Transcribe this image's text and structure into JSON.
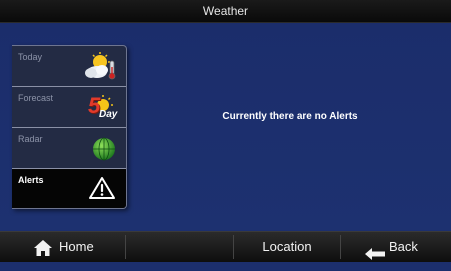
{
  "header": {
    "title": "Weather"
  },
  "main": {
    "message": "Currently there are no Alerts"
  },
  "sidebar": {
    "tabs": [
      {
        "label": "Today",
        "icon": "partly-cloudy-thermometer-icon"
      },
      {
        "label": "Forecast",
        "icon": "five-day-forecast-icon",
        "badge_number": "5",
        "badge_text": "Day"
      },
      {
        "label": "Radar",
        "icon": "radar-globe-icon"
      },
      {
        "label": "Alerts",
        "icon": "alert-warning-icon",
        "selected": true
      }
    ]
  },
  "footer": {
    "home_label": "Home",
    "location_label": "Location",
    "back_label": "Back"
  },
  "colors": {
    "background": "#1c2f6e",
    "sidebar": "#232b44",
    "active_tab": "#050505"
  }
}
